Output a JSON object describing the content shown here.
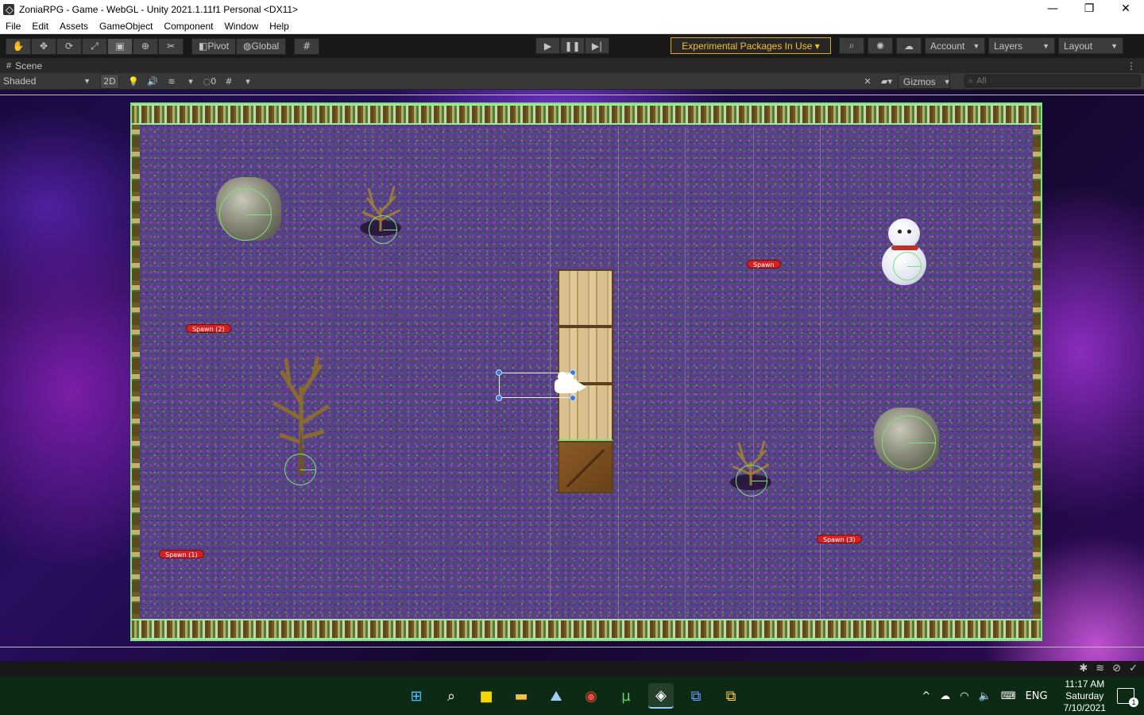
{
  "window": {
    "title": "ZoniaRPG - Game - WebGL - Unity 2021.1.11f1 Personal <DX11>",
    "minimize": "—",
    "maximize": "❐",
    "close": "✕"
  },
  "menu": [
    "File",
    "Edit",
    "Assets",
    "GameObject",
    "Component",
    "Window",
    "Help"
  ],
  "toolbar": {
    "pivot": "Pivot",
    "global": "Global",
    "experimental": "Experimental Packages In Use ▾",
    "account": "Account",
    "layers": "Layers",
    "layout": "Layout"
  },
  "scene_tab": {
    "label": "Scene"
  },
  "scene_toolbar": {
    "shading": "Shaded",
    "mode_2d": "2D",
    "hidden_count": "0",
    "gizmos": "Gizmos",
    "search_placeholder": "All"
  },
  "scene": {
    "spawns": [
      "Spawn",
      "Spawn (2)",
      "Spawn (1)",
      "Spawn (3)"
    ]
  },
  "taskbar": {
    "lang": "ENG",
    "time": "11:17 AM",
    "day": "Saturday",
    "date": "7/10/2021",
    "notifications": "1"
  }
}
